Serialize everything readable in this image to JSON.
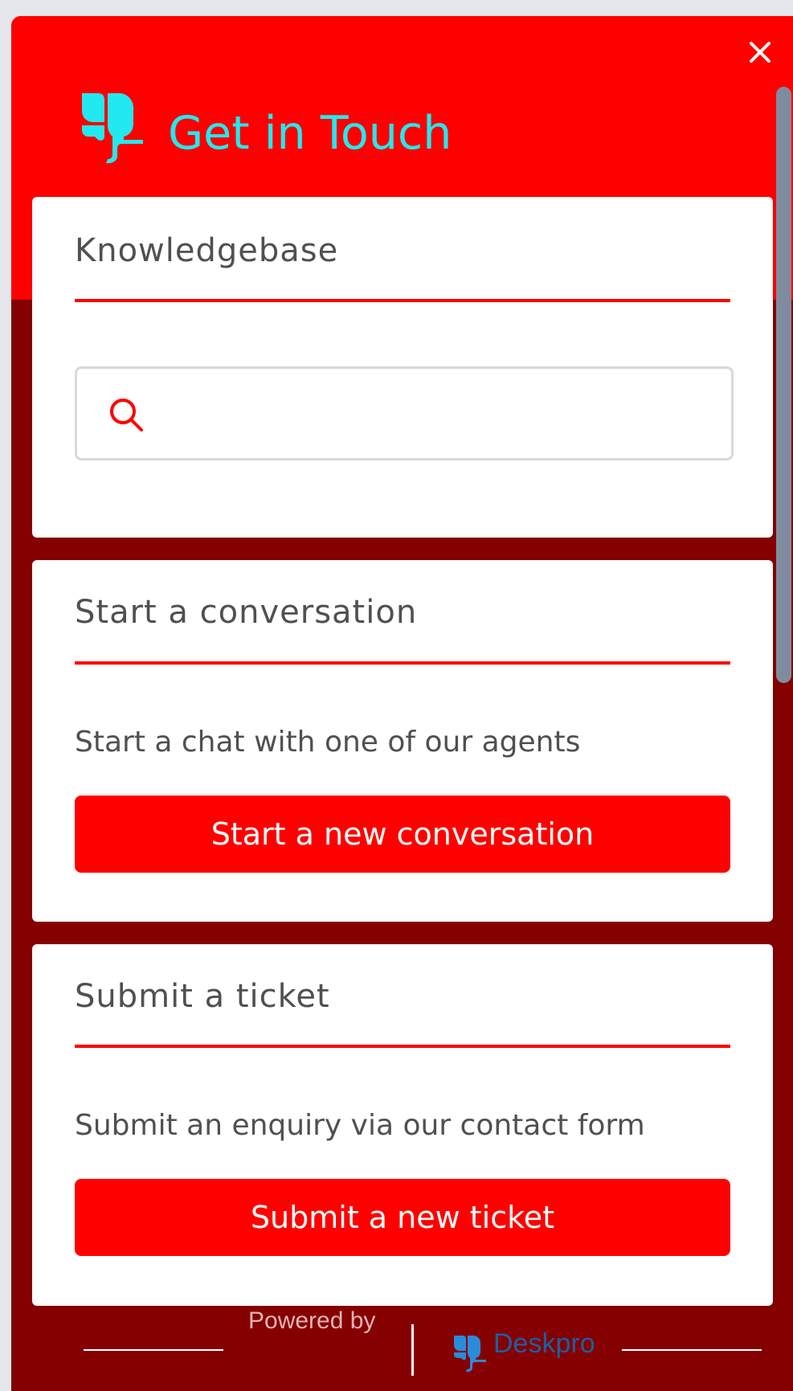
{
  "colors": {
    "header_bg": "#ff0000",
    "body_bg": "#850000",
    "title_text": "#22e9ef",
    "accent": "#ff0000",
    "card_bg": "#ffffff",
    "text": "#505050",
    "deskpro_blue": "#2b8bd8"
  },
  "header": {
    "title": "Get in Touch",
    "logo_icon": "deskpro-elephant-icon",
    "close_icon": "close-icon"
  },
  "knowledgebase": {
    "title": "Knowledgebase",
    "search_icon": "search-icon",
    "search_value": "",
    "search_placeholder": ""
  },
  "conversation": {
    "title": "Start a conversation",
    "description": "Start a chat with one of our agents",
    "button_label": "Start a new conversation"
  },
  "ticket": {
    "title": "Submit a ticket",
    "description": "Submit an enquiry via our contact form",
    "button_label": "Submit a new ticket"
  },
  "footer": {
    "powered_by": "Powered by",
    "brand": "Deskpro",
    "brand_icon": "deskpro-elephant-icon"
  }
}
